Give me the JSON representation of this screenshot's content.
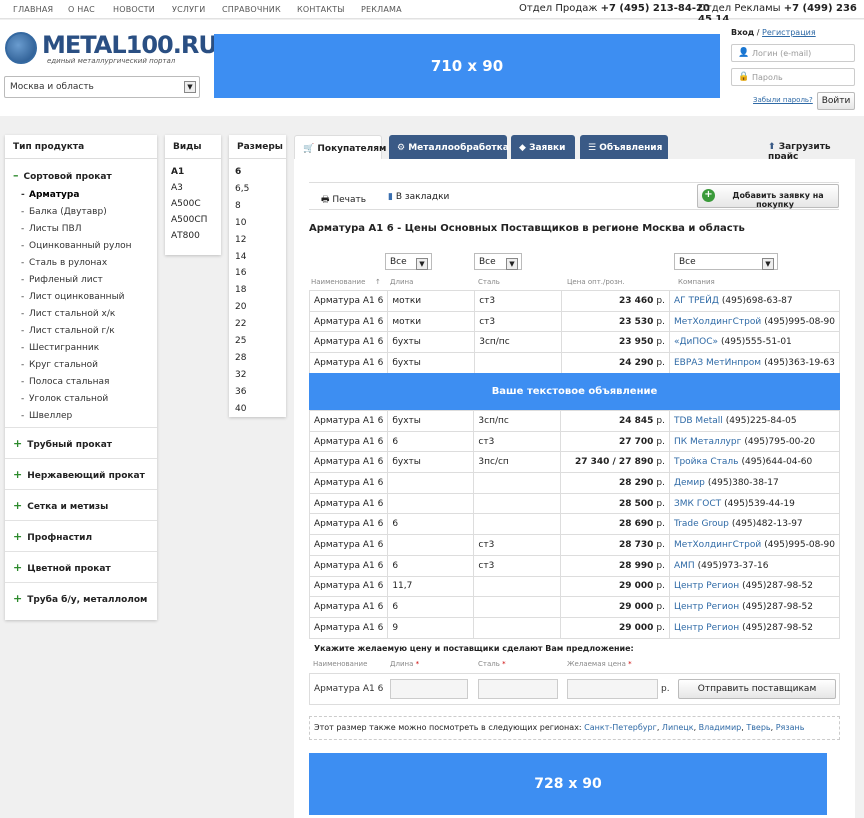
{
  "nav": {
    "items": [
      "ГЛАВНАЯ",
      "О НАС",
      "НОВОСТИ",
      "УСЛУГИ",
      "СПРАВОЧНИК",
      "КОНТАКТЫ",
      "РЕКЛАМА"
    ],
    "sales_label": "Отдел Продаж",
    "sales_phone": "+7 (495) 213-84-20",
    "ads_label": "Отдел Рекламы",
    "ads_phone": "+7 (499) 236 45 14"
  },
  "header": {
    "logo_text": "METAL100.RU",
    "logo_sub": "единый металлургический портал",
    "region": "Москва и область",
    "banner": "710 x 90"
  },
  "login": {
    "login_label": "Вход",
    "separator": "/",
    "register_label": "Регистрация",
    "login_placeholder": "Логин (e-mail)",
    "password_placeholder": "Пароль",
    "forgot": "Забыли пароль?",
    "submit": "Войти"
  },
  "product_types": {
    "header": "Тип продукта",
    "open_category": "Сортовой прокат",
    "subitems": [
      "Арматура",
      "Балка (Двутавр)",
      "Листы ПВЛ",
      "Оцинкованный рулон",
      "Сталь в рулонах",
      "Рифленый лист",
      "Лист оцинкованный",
      "Лист стальной х/к",
      "Лист стальной г/к",
      "Шестигранник",
      "Круг стальной",
      "Полоса стальная",
      "Уголок стальной",
      "Швеллер"
    ],
    "categories": [
      "Трубный прокат",
      "Нержавеющий прокат",
      "Сетка и метизы",
      "Профнастил",
      "Цветной прокат",
      "Труба б/у, металлолом"
    ]
  },
  "kinds": {
    "header": "Виды",
    "items": [
      "А1",
      "А3",
      "А500С",
      "А500СП",
      "АТ800"
    ]
  },
  "sizes": {
    "header": "Размеры",
    "items": [
      "6",
      "6,5",
      "8",
      "10",
      "12",
      "14",
      "16",
      "18",
      "20",
      "22",
      "25",
      "28",
      "32",
      "36",
      "40"
    ]
  },
  "tabs": [
    "Покупателям",
    "Металлообработка",
    "Заявки",
    "Объявления"
  ],
  "upload_label": "Загрузить прайс",
  "toolbar": {
    "print": "Печать",
    "bookmark": "В закладки",
    "add_request": "Добавить заявку на покупку"
  },
  "page_title": "Арматура А1 6 - Цены Основных Поставщиков в регионе Москва и область",
  "filters": {
    "length": "Все",
    "steel": "Все",
    "company": "Все"
  },
  "columns": {
    "name": "Наименование",
    "sort": "↑",
    "length": "Длина",
    "steel": "Сталь",
    "price": "Цена опт./розн.",
    "company": "Компания"
  },
  "rows_top": [
    {
      "name": "Арматура А1 6",
      "length": "мотки",
      "steel": "ст3",
      "price": "23 460",
      "currency": "р.",
      "company": "АГ ТРЕЙД",
      "phone": "(495)698-63-87"
    },
    {
      "name": "Арматура А1 6",
      "length": "мотки",
      "steel": "ст3",
      "price": "23 530",
      "currency": "р.",
      "company": "МетХолдингСтрой",
      "phone": "(495)995-08-90"
    },
    {
      "name": "Арматура А1 6",
      "length": "бухты",
      "steel": "3сп/пс",
      "price": "23 950",
      "currency": "р.",
      "company": "«ДиПОС»",
      "phone": "(495)555-51-01"
    },
    {
      "name": "Арматура А1 6",
      "length": "бухты",
      "steel": "",
      "price": "24 290",
      "currency": "р.",
      "company": "ЕВРАЗ МетИнпром",
      "phone": "(495)363-19-63"
    }
  ],
  "ad_row": "Ваше текстовое объявление",
  "rows_bottom": [
    {
      "name": "Арматура А1 6",
      "length": "бухты",
      "steel": "3сп/пс",
      "price": "24 845",
      "currency": "р.",
      "company": "TDB Metall",
      "phone": "(495)225-84-05"
    },
    {
      "name": "Арматура А1 6",
      "length": "6",
      "steel": "ст3",
      "price": "27 700",
      "currency": "р.",
      "company": "ПК Металлург",
      "phone": "(495)795-00-20"
    },
    {
      "name": "Арматура А1 6",
      "length": "бухты",
      "steel": "3пс/сп",
      "price": "27 340 / 27 890",
      "currency": "р.",
      "company": "Тройка Сталь",
      "phone": "(495)644-04-60"
    },
    {
      "name": "Арматура А1 6",
      "length": "",
      "steel": "",
      "price": "28 290",
      "currency": "р.",
      "company": "Демир",
      "phone": "(495)380-38-17"
    },
    {
      "name": "Арматура А1 6",
      "length": "",
      "steel": "",
      "price": "28 500",
      "currency": "р.",
      "company": "ЗМК ГОСТ",
      "phone": "(495)539-44-19"
    },
    {
      "name": "Арматура А1 6",
      "length": "6",
      "steel": "",
      "price": "28 690",
      "currency": "р.",
      "company": "Trade Group",
      "phone": "(495)482-13-97"
    },
    {
      "name": "Арматура А1 6",
      "length": "",
      "steel": "ст3",
      "price": "28 730",
      "currency": "р.",
      "company": "МетХолдингСтрой",
      "phone": "(495)995-08-90"
    },
    {
      "name": "Арматура А1 6",
      "length": "6",
      "steel": "ст3",
      "price": "28 990",
      "currency": "р.",
      "company": "АМП",
      "phone": "(495)973-37-16"
    },
    {
      "name": "Арматура А1 6",
      "length": "11,7",
      "steel": "",
      "price": "29 000",
      "currency": "р.",
      "company": "Центр Регион",
      "phone": "(495)287-98-52"
    },
    {
      "name": "Арматура А1 6",
      "length": "6",
      "steel": "",
      "price": "29 000",
      "currency": "р.",
      "company": "Центр Регион",
      "phone": "(495)287-98-52"
    },
    {
      "name": "Арматура А1 6",
      "length": "9",
      "steel": "",
      "price": "29 000",
      "currency": "р.",
      "company": "Центр Регион",
      "phone": "(495)287-98-52"
    }
  ],
  "offer": {
    "title": "Укажите желаемую цену и поставщики сделают Вам предложение:",
    "h_name": "Наименование",
    "h_length": "Длина",
    "h_steel": "Сталь",
    "h_price": "Желаемая цена",
    "required": "*",
    "name": "Арматура А1 6",
    "currency": "р.",
    "submit": "Отправить поставщикам"
  },
  "regions": {
    "prefix": "Этот размер также можно посмотреть в следующих регионах:",
    "list": [
      "Санкт-Петербург",
      "Липецк",
      "Владимир",
      "Тверь",
      "Рязань"
    ]
  },
  "banner_bottom": "728 x 90",
  "colors": {
    "accent": "#3d8ef2",
    "tab_dark": "#3a5a86",
    "link": "#2f6aa6",
    "plus": "#2c8a2c"
  }
}
